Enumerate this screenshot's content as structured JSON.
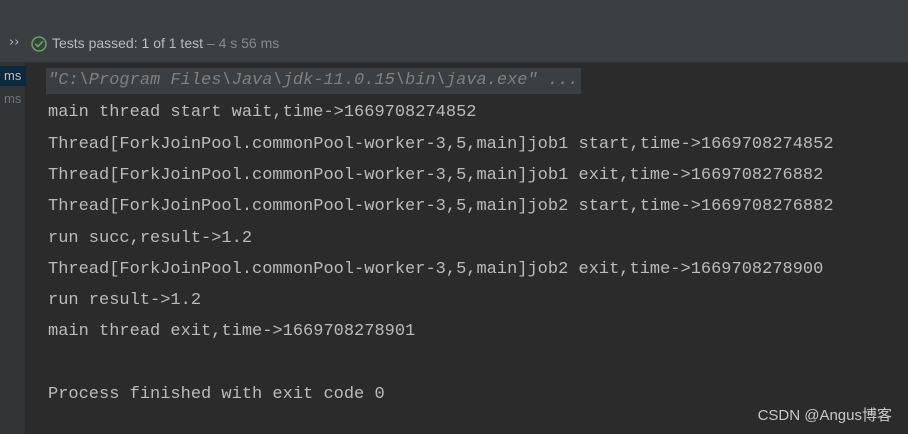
{
  "header": {
    "expand_icon": "double-chevron-right-icon",
    "status_icon": "check-circle-icon",
    "status_color": "#5fa35f",
    "status_prefix": "Tests passed:",
    "status_count": "1",
    "status_of": "of 1 test",
    "status_duration": "– 4 s 56 ms"
  },
  "sidebar": {
    "items": [
      {
        "label": "ms",
        "selected": true
      },
      {
        "label": "ms",
        "selected": false
      }
    ]
  },
  "console": {
    "command": "\"C:\\Program Files\\Java\\jdk-11.0.15\\bin\\java.exe\" ...",
    "lines": [
      "main thread start wait,time->1669708274852",
      "Thread[ForkJoinPool.commonPool-worker-3,5,main]job1 start,time->1669708274852",
      "Thread[ForkJoinPool.commonPool-worker-3,5,main]job1 exit,time->1669708276882",
      "Thread[ForkJoinPool.commonPool-worker-3,5,main]job2 start,time->1669708276882",
      "run succ,result->1.2",
      "Thread[ForkJoinPool.commonPool-worker-3,5,main]job2 exit,time->1669708278900",
      "run result->1.2",
      "main thread exit,time->1669708278901",
      "",
      "Process finished with exit code 0"
    ]
  },
  "watermark": "CSDN @Angus博客",
  "colors": {
    "background": "#2b2b2b",
    "text": "#bbbbbb",
    "command_bg": "#3b3f42",
    "command_text": "#808080"
  }
}
